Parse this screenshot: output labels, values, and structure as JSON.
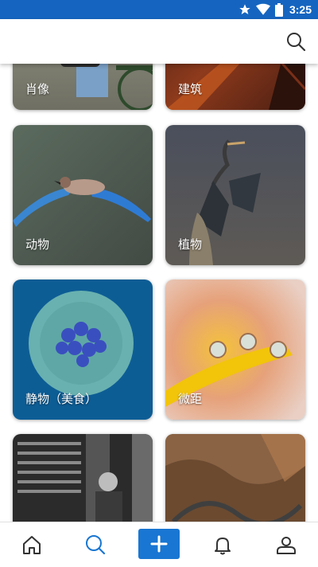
{
  "status_bar": {
    "time": "3:25",
    "icons": [
      "star-icon",
      "wifi-icon",
      "battery-icon"
    ]
  },
  "header": {
    "search_icon": "search-icon"
  },
  "categories": [
    {
      "label": "肖像"
    },
    {
      "label": "建筑"
    },
    {
      "label": "动物"
    },
    {
      "label": "植物"
    },
    {
      "label": "静物（美食）"
    },
    {
      "label": "微距"
    },
    {
      "label": ""
    },
    {
      "label": ""
    }
  ],
  "bottom_nav": {
    "items": [
      "home-icon",
      "search-icon",
      "add-icon",
      "bell-icon",
      "profile-icon"
    ],
    "active": "search-icon"
  },
  "colors": {
    "status_bar": "#1565c0",
    "accent": "#1976d2"
  }
}
